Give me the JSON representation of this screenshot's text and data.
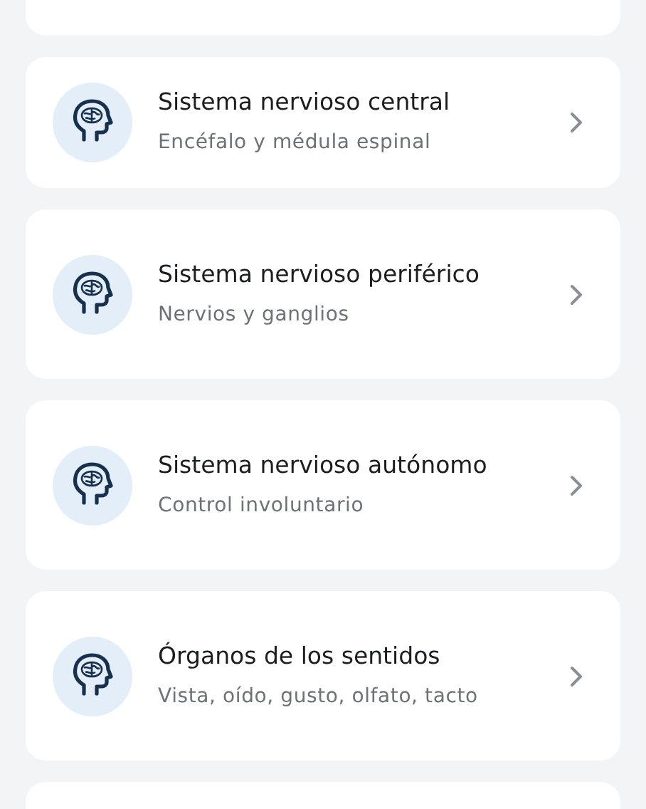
{
  "items": [
    {
      "title": "Sistema nervioso central",
      "subtitle": "Encéfalo y médula espinal"
    },
    {
      "title": "Sistema nervioso periférico",
      "subtitle": "Nervios y ganglios"
    },
    {
      "title": "Sistema nervioso autónomo",
      "subtitle": "Control involuntario"
    },
    {
      "title": "Órganos de los sentidos",
      "subtitle": "Vista, oído, gusto, olfato, tacto"
    }
  ]
}
